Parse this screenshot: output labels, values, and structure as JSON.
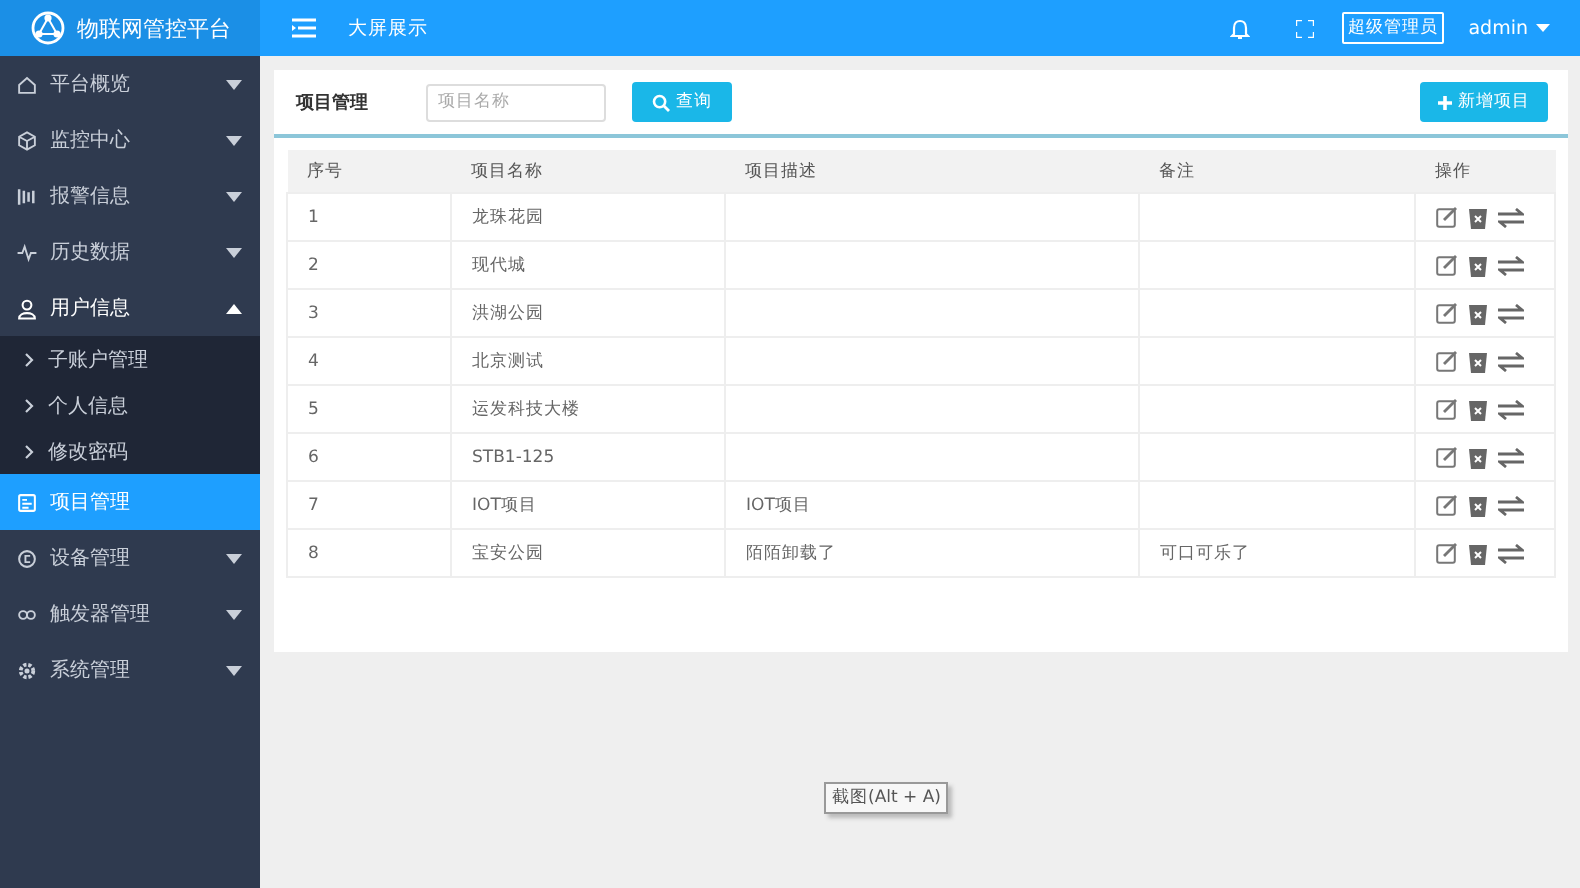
{
  "sidebar": {
    "brand": "物联网管控平台",
    "items": [
      {
        "label": "平台概览",
        "expanded": false,
        "selected": false
      },
      {
        "label": "监控中心",
        "expanded": false,
        "selected": false
      },
      {
        "label": "报警信息",
        "expanded": false,
        "selected": false
      },
      {
        "label": "历史数据",
        "expanded": false,
        "selected": false
      },
      {
        "label": "用户信息",
        "expanded": true,
        "selected": false,
        "children": [
          {
            "label": "子账户管理"
          },
          {
            "label": "个人信息"
          },
          {
            "label": "修改密码"
          }
        ]
      },
      {
        "label": "项目管理",
        "selected": true
      },
      {
        "label": "设备管理",
        "expanded": false,
        "selected": false
      },
      {
        "label": "触发器管理",
        "expanded": false,
        "selected": false
      },
      {
        "label": "系统管理",
        "expanded": false,
        "selected": false
      }
    ]
  },
  "header": {
    "nav_link": "大屏展示",
    "role_badge": "超级管理员",
    "user": "admin"
  },
  "panel": {
    "title": "项目管理",
    "search": {
      "placeholder": "项目名称"
    },
    "search_button": "查询",
    "add_button": "新增项目",
    "table": {
      "columns": [
        "序号",
        "项目名称",
        "项目描述",
        "备注",
        "操作"
      ],
      "rows": [
        [
          "1",
          "龙珠花园",
          "",
          ""
        ],
        [
          "2",
          "现代城",
          "",
          ""
        ],
        [
          "3",
          "洪湖公园",
          "",
          ""
        ],
        [
          "4",
          "北京测试",
          "",
          ""
        ],
        [
          "5",
          "运发科技大楼",
          "",
          ""
        ],
        [
          "6",
          "STB1-125",
          "",
          ""
        ],
        [
          "7",
          "IOT项目",
          "IOT项目",
          ""
        ],
        [
          "8",
          "宝安公园",
          "陌陌卸载了",
          "可口可乐了"
        ]
      ]
    }
  },
  "tooltip": "截图(Alt + A)"
}
